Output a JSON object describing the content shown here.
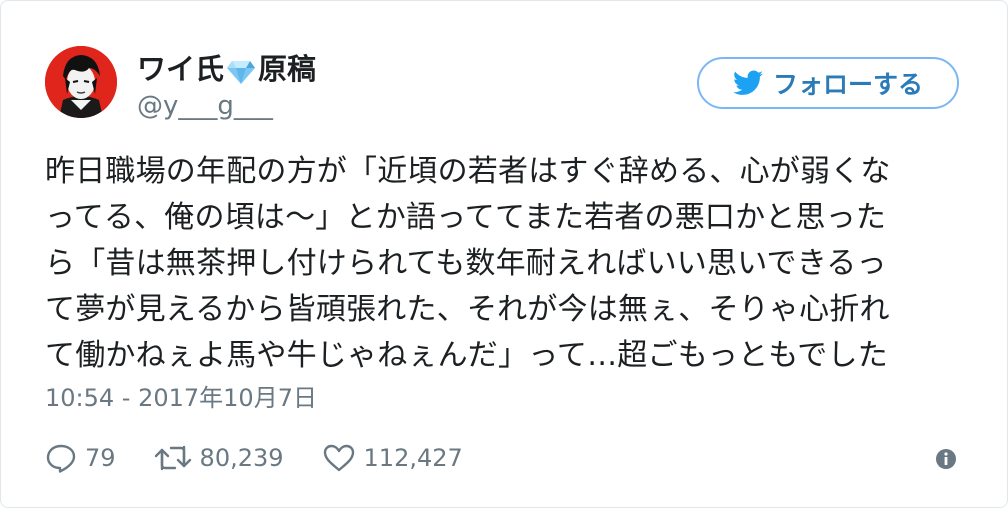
{
  "author": {
    "display_name_prefix": "ワイ氏",
    "display_name_suffix": "原稿",
    "username": "@y___g___"
  },
  "follow_button": {
    "label": "フォローする",
    "icon": "twitter-bird-icon"
  },
  "tweet": {
    "text": "昨日職場の年配の方が「近頃の若者はすぐ辞める、心が弱くな\nってる、俺の頃は〜」とか語っててまた若者の悪口かと思った\nら「昔は無茶押し付けられても数年耐えればいい思いできるっ\nて夢が見えるから皆頑張れた、それが今は無ぇ、そりゃ心折れ\nて働かねぇよ馬や牛じゃねぇんだ」って…超ごもっともでした",
    "timestamp": "10:54 - 2017年10月7日"
  },
  "actions": {
    "reply_count": "79",
    "retweet_count": "80,239",
    "like_count": "112,427"
  },
  "colors": {
    "accent": "#1da1f2",
    "follow_border": "#7ab8f5",
    "follow_text": "#2b7bb9",
    "secondary_text": "#697882",
    "avatar_background": "#e0261c"
  }
}
